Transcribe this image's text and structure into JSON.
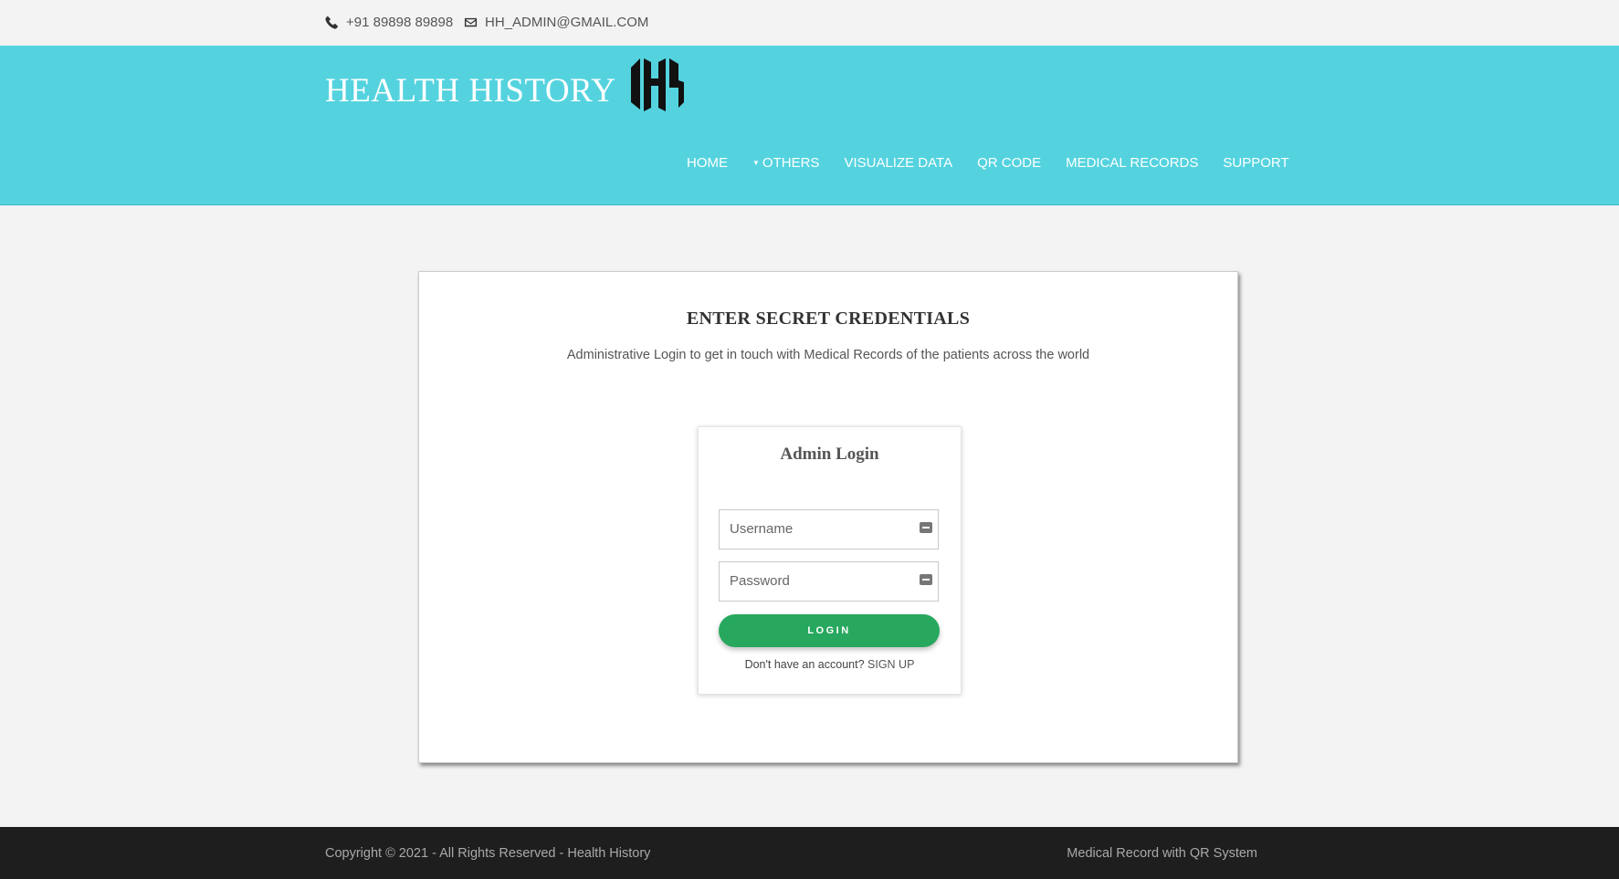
{
  "topbar": {
    "phone": "+91 89898 89898",
    "email": "HH_ADMIN@GMAIL.COM",
    "phone_icon": "phone-icon",
    "email_icon": "envelope-icon"
  },
  "header": {
    "brand": "HEALTH HISTORY",
    "logo_icon": "hh-logo",
    "background_color": "#54d3df",
    "nav": [
      {
        "label": "HOME"
      },
      {
        "label": "OTHERS",
        "has_dropdown": true
      },
      {
        "label": "VISUALIZE DATA"
      },
      {
        "label": "QR CODE"
      },
      {
        "label": "MEDICAL RECORDS"
      },
      {
        "label": "SUPPORT"
      }
    ]
  },
  "main": {
    "title": "ENTER SECRET CREDENTIALS",
    "subtitle": "Administrative Login to get in touch with Medical Records of the patients across the world",
    "login": {
      "title": "Admin Login",
      "username_placeholder": "Username",
      "password_placeholder": "Password",
      "button_label": "LOGIN",
      "button_color": "#27a85e",
      "signup_prompt": "Don't have an account?",
      "signup_link": "SIGN UP"
    }
  },
  "footer": {
    "copyright": "Copyright © 2021 - All Rights Reserved - Health History",
    "tagline": "Medical Record with QR System"
  }
}
